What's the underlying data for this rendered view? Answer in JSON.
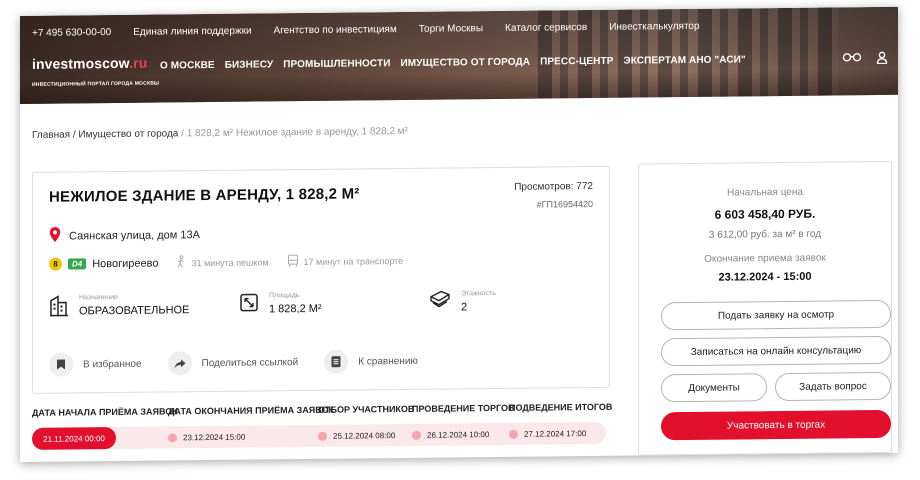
{
  "header": {
    "topbar": [
      "+7 495 630-00-00",
      "Единая линия поддержки",
      "Агентство по инвестициям",
      "Торги Москвы",
      "Каталог сервисов",
      "Инвесткалькулятор"
    ],
    "logo_main": "investmoscow",
    "logo_dot": ".ru",
    "logo_sub": "ИНВЕСТИЦИОННЫЙ ПОРТАЛ ГОРОДА МОСКВЫ",
    "nav": [
      "О МОСКВЕ",
      "БИЗНЕСУ",
      "ПРОМЫШЛЕННОСТИ",
      "ИМУЩЕСТВО ОТ ГОРОДА",
      "ПРЕСС-ЦЕНТР",
      "ЭКСПЕРТАМ АНО \"АСИ\""
    ],
    "icons": [
      "glasses-icon",
      "user-icon"
    ]
  },
  "breadcrumb": {
    "home": "Главная",
    "sep": " / ",
    "section": "Имущество от города",
    "current": " / 1 828,2 м² Нежилое здание в аренду, 1 828,2 м²"
  },
  "listing": {
    "title": "НЕЖИЛОЕ ЗДАНИЕ В АРЕНДУ, 1 828,2 М²",
    "views": "Просмотров: 772",
    "code": "#ГП16954420",
    "address": "Саянская улица, дом 13А",
    "metro_line": "8",
    "mcd_line": "D4",
    "metro_station": "Новогиреево",
    "walk": "31 минута пешком",
    "transport": "17 минут на транспорте",
    "props": [
      {
        "label": "Назначение",
        "value": "ОБРАЗОВАТЕЛЬНОЕ",
        "icon": "building-icon"
      },
      {
        "label": "Площадь",
        "value": "1 828,2 М²",
        "icon": "area-icon"
      },
      {
        "label": "Этажность",
        "value": "2",
        "icon": "floors-icon"
      }
    ],
    "actions": [
      {
        "label": "В избранное",
        "icon": "bookmark-icon"
      },
      {
        "label": "Поделиться ссылкой",
        "icon": "share-icon"
      },
      {
        "label": "К сравнению",
        "icon": "compare-icon"
      }
    ]
  },
  "timeline": {
    "heads": [
      "ДАТА НАЧАЛА ПРИЁМА ЗАЯВОК",
      "ДАТА ОКОНЧАНИЯ ПРИЁМА ЗАЯВОК",
      "ОТБОР УЧАСТНИКОВ",
      "ПРОВЕДЕНИЕ ТОРГОВ",
      "ПОДВЕДЕНИЕ ИТОГОВ"
    ],
    "dates": [
      "21.11.2024 00:00",
      "23.12.2024 15:00",
      "25.12.2024 08:00",
      "26.12.2024 10:00",
      "27.12.2024 17:00"
    ]
  },
  "sidebar": {
    "start_price_label": "Начальная цена",
    "start_price": "6 603 458,40 РУБ.",
    "per_m2": "3 612,00 руб. за м² в год",
    "deadline_label": "Окончание приема заявок",
    "deadline": "23.12.2024 - 15:00",
    "btn_inspect": "Подать заявку на осмотр",
    "btn_consult": "Записаться на онлайн консультацию",
    "btn_docs": "Документы",
    "btn_question": "Задать вопрос",
    "btn_participate": "Участвовать в торгах"
  },
  "colors": {
    "accent": "#e3102d",
    "accent_light": "#fbe8ea",
    "metro8": "#f7c400",
    "mcd4": "#36a84a"
  }
}
